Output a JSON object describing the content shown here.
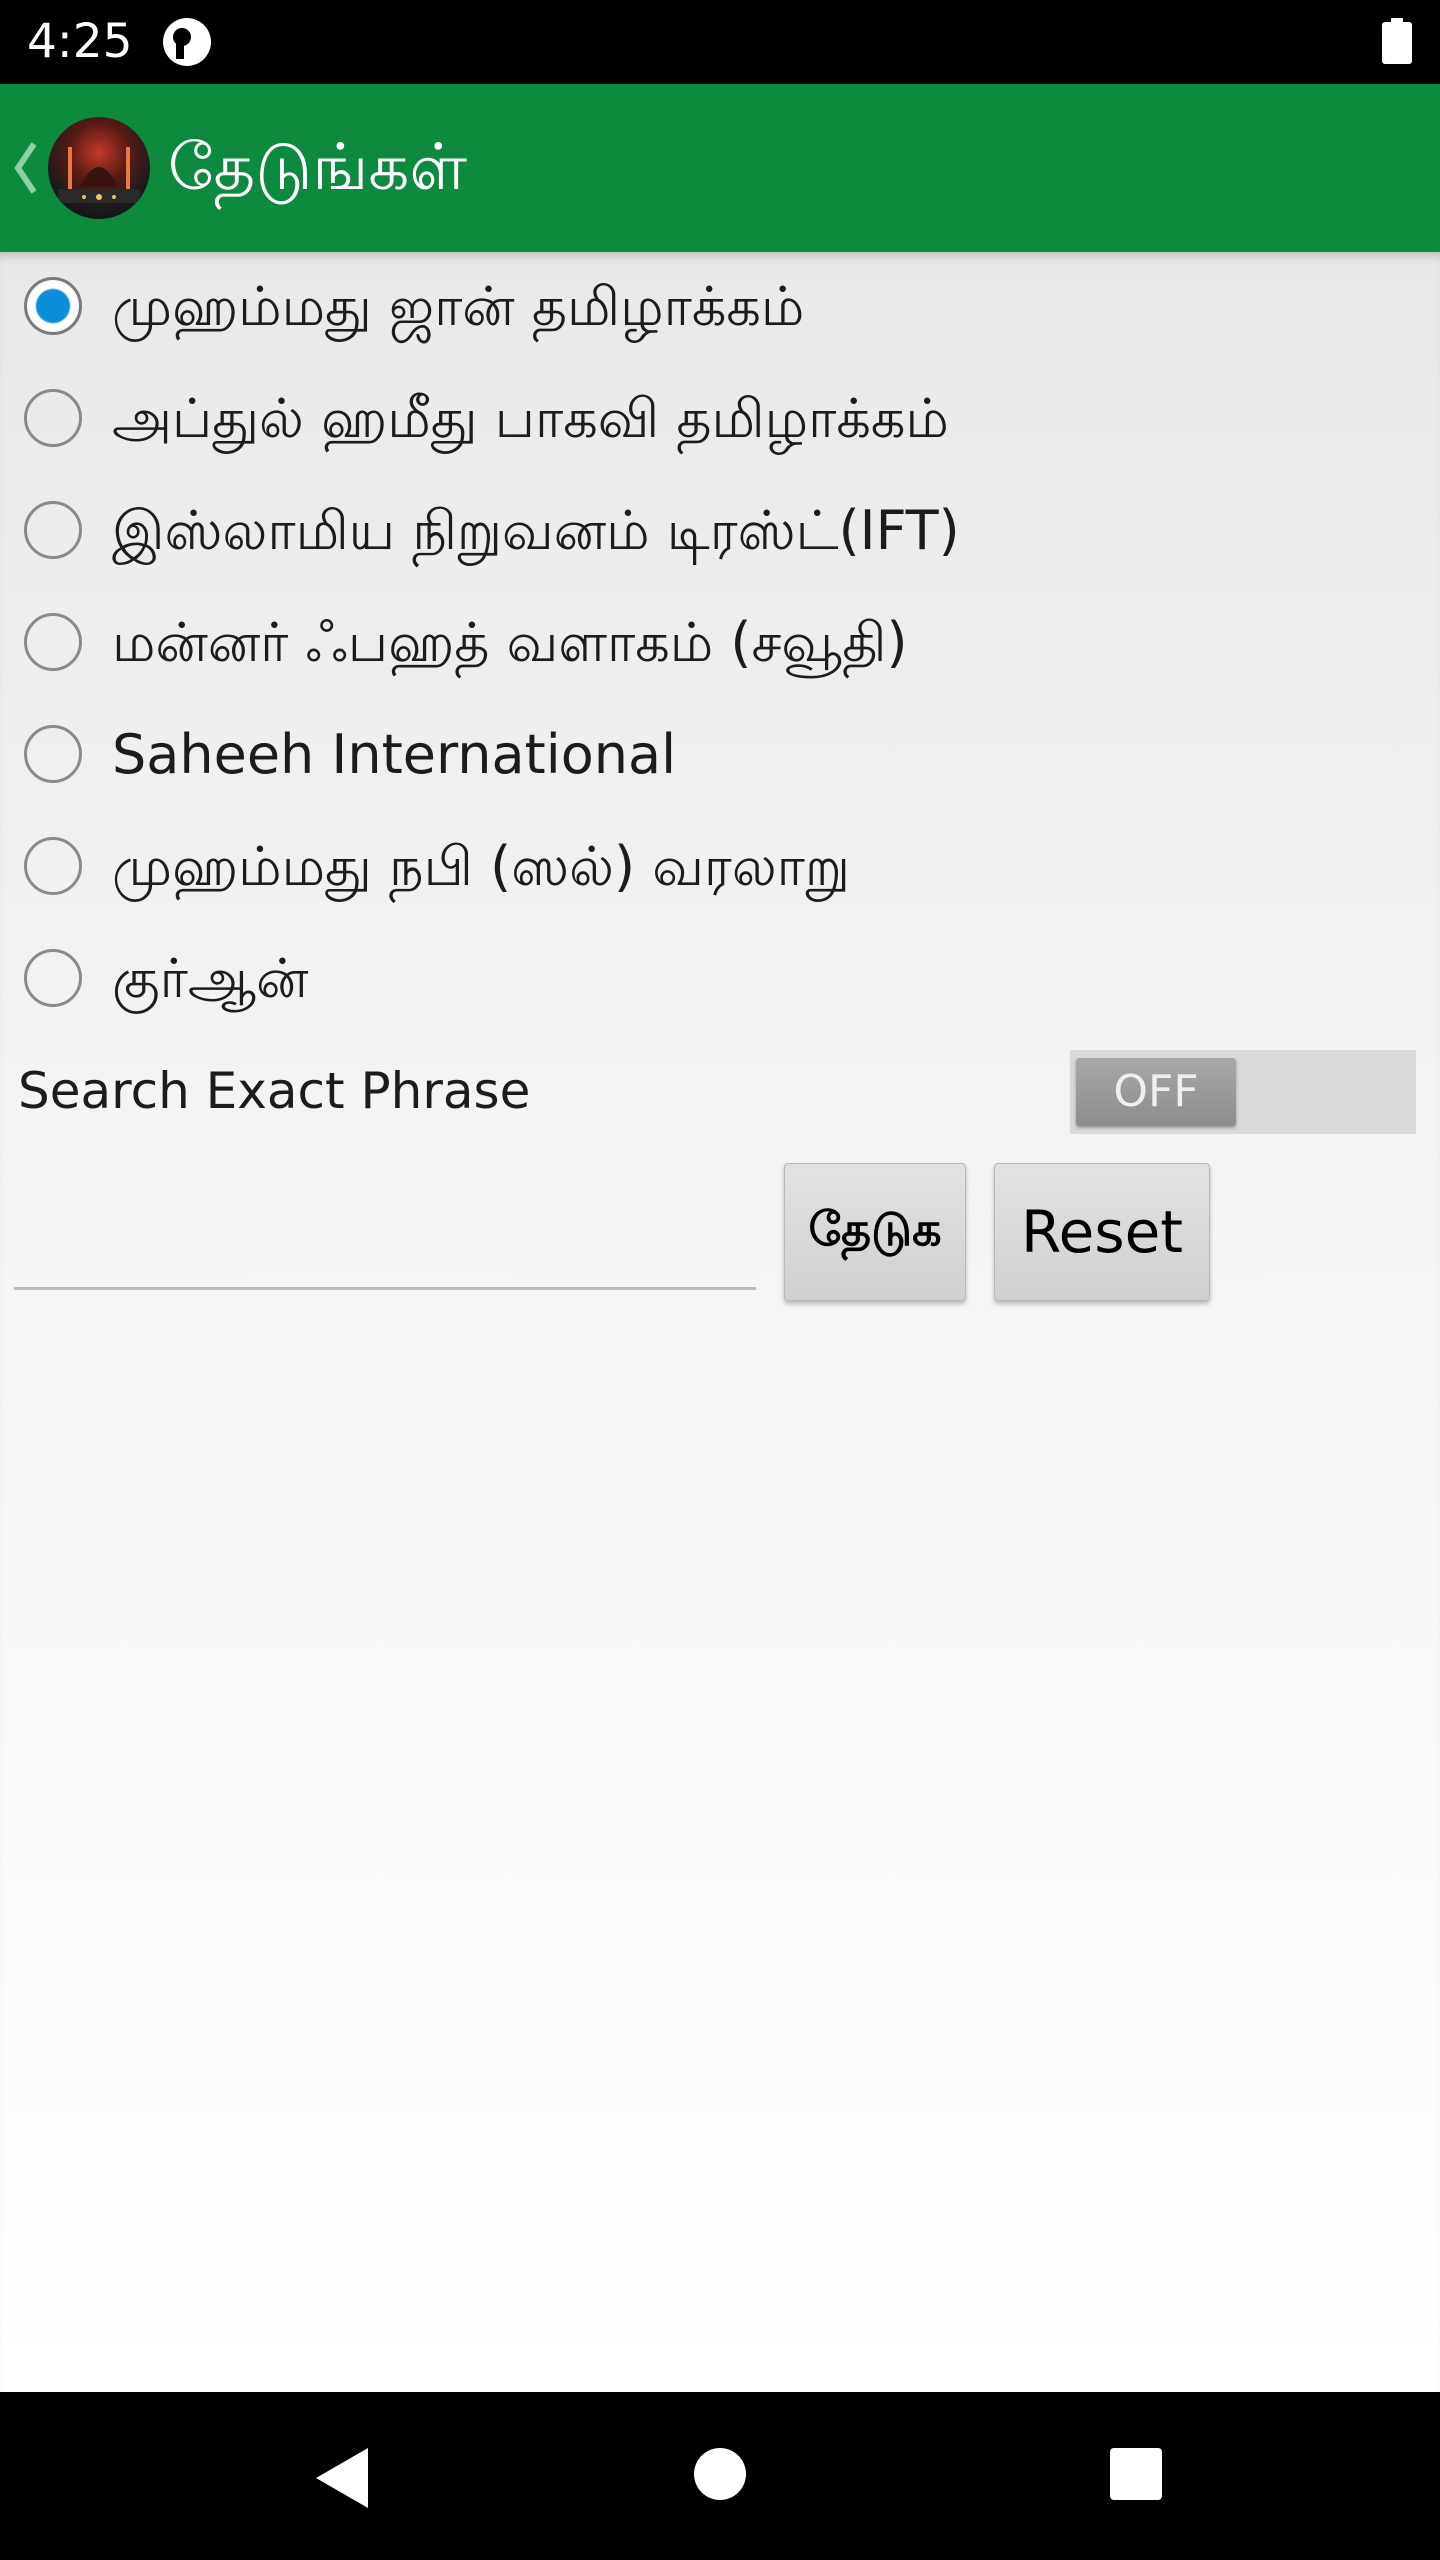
{
  "status_bar": {
    "time": "4:25",
    "app_icon": "notification-app-icon",
    "battery_icon": "battery-full-icon"
  },
  "action_bar": {
    "title": "தேடுங்கள்",
    "back_icon": "chevron-left-icon",
    "logo": "mosque-logo",
    "background_color": "#0e8a3e"
  },
  "options": [
    {
      "label": "முஹம்மது ஜான் தமிழாக்கம்",
      "checked": true
    },
    {
      "label": "அப்துல் ஹமீது பாகவி தமிழாக்கம்",
      "checked": false
    },
    {
      "label": "இஸ்லாமிய நிறுவனம் டிரஸ்ட்(IFT)",
      "checked": false
    },
    {
      "label": "மன்னர் ஃபஹத் வளாகம் (சவூதி)",
      "checked": false
    },
    {
      "label": "Saheeh International",
      "checked": false
    },
    {
      "label": "முஹம்மது நபி (ஸல்) வரலாறு",
      "checked": false
    },
    {
      "label": "குர்ஆன்",
      "checked": false
    }
  ],
  "exact_phrase": {
    "label": "Search Exact Phrase",
    "toggle_text": "OFF",
    "on": false
  },
  "search": {
    "input_value": "",
    "placeholder": "",
    "search_button": "தேடுக",
    "reset_button": "Reset"
  },
  "nav_bar": {
    "back_icon": "back-triangle-icon",
    "home_icon": "home-circle-icon",
    "recents_icon": "recents-square-icon"
  },
  "colors": {
    "accent_radio": "#0a8fd8",
    "toolbar": "#0e8a3e"
  }
}
